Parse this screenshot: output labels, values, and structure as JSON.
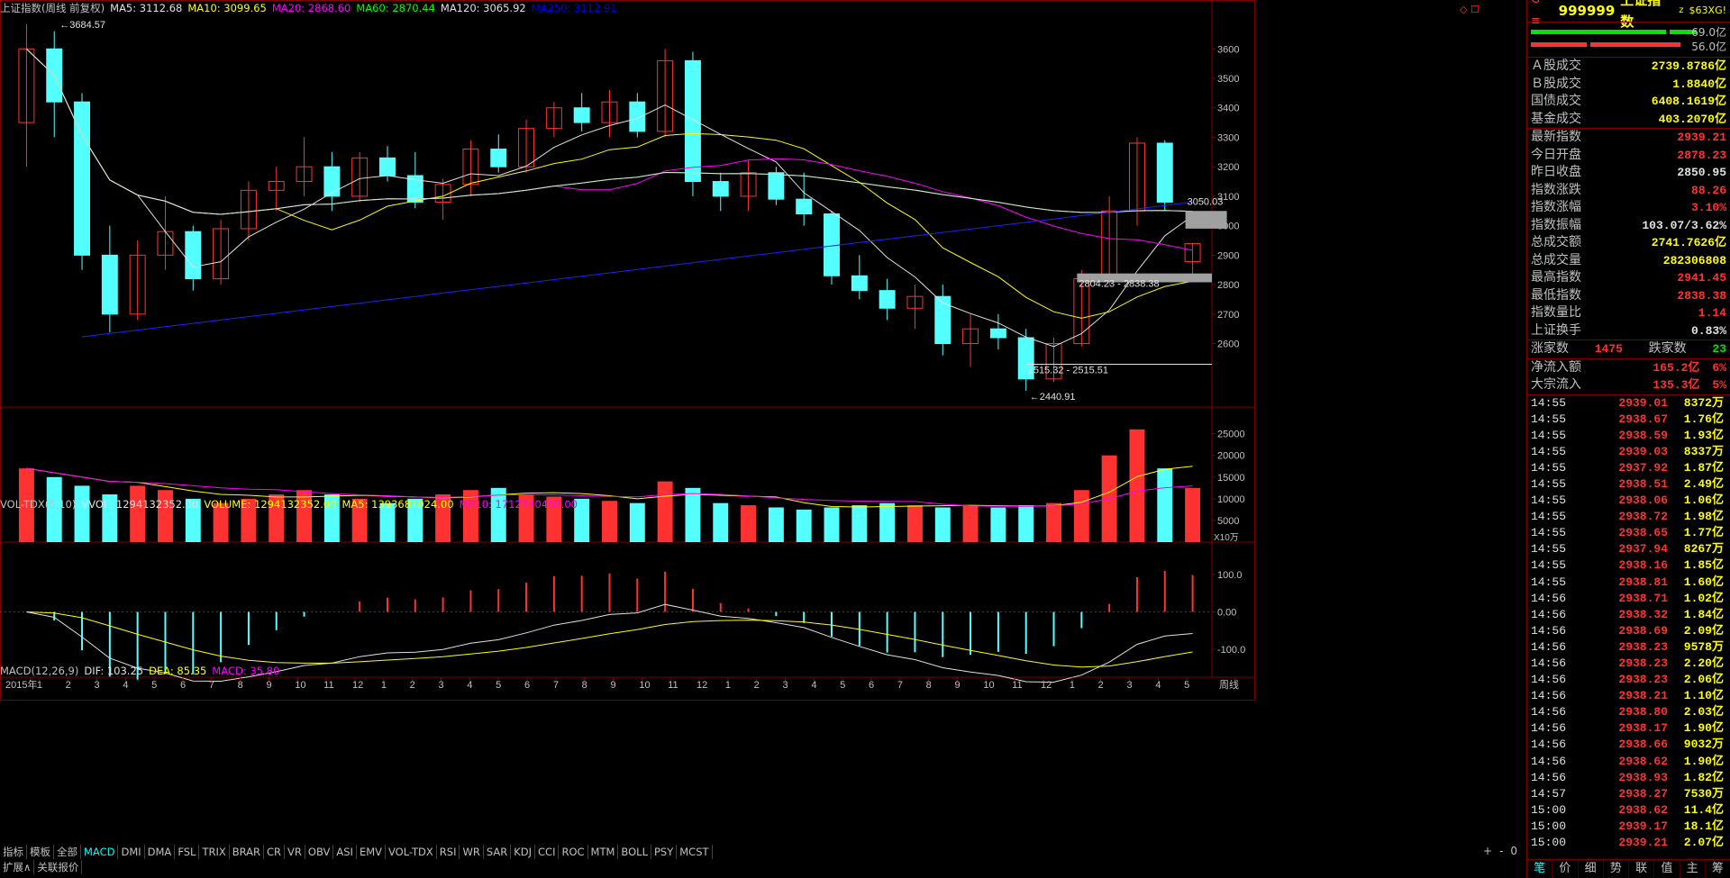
{
  "main_legend": [
    {
      "text": "上证指数(周线 前复权)",
      "color": "#c0c0c0"
    },
    {
      "text": "MA5: 3112.68",
      "color": "#e0e0e0"
    },
    {
      "text": "MA10: 3099.65",
      "color": "#ffff00"
    },
    {
      "text": "MA20: 2868.60",
      "color": "#ff00ff"
    },
    {
      "text": "MA60: 2870.44",
      "color": "#00ff00"
    },
    {
      "text": "MA120: 3065.92",
      "color": "#e0e0e0"
    },
    {
      "text": "MA250: 3112.91",
      "color": "#0000ff"
    }
  ],
  "vol_legend": [
    {
      "text": "VOL-TDX(5,10)",
      "color": "#c0c0c0"
    },
    {
      "text": "VVOL: 1294132352.00",
      "color": "#e0e0e0"
    },
    {
      "text": "VOLUME: 1294132352.00",
      "color": "#ffff00"
    },
    {
      "text": "MA5: 1393681024.00",
      "color": "#ffff00"
    },
    {
      "text": "MA10: 1712740480.00",
      "color": "#ff00ff"
    }
  ],
  "macd_legend": [
    {
      "text": "MACD(12,26,9)",
      "color": "#c0c0c0"
    },
    {
      "text": "DIF: 103.25",
      "color": "#e0e0e0"
    },
    {
      "text": "DEA: 85.35",
      "color": "#ffff00"
    },
    {
      "text": "MACD: 35.80",
      "color": "#ff00ff"
    }
  ],
  "annotations": {
    "high_label": "3684.57",
    "low_label": "2440.91",
    "label_3050": "3050.03",
    "gap1": "2804.23 - 2838.38",
    "gap2": "2515.32 - 2515.51"
  },
  "y_axis_main": [
    "3600",
    "3500",
    "3400",
    "3300",
    "3200",
    "3100",
    "3000",
    "2900",
    "2800",
    "2700",
    "2600"
  ],
  "y_axis_vol": [
    "25000",
    "20000",
    "15000",
    "10000",
    "5000"
  ],
  "vol_unit": "X10万",
  "y_axis_macd": [
    "100.0",
    "0.00",
    "-100.0"
  ],
  "period_label": "周线",
  "x_axis_labels": [
    "2015年",
    "1",
    "2",
    "3",
    "4",
    "5",
    "6",
    "7",
    "8",
    "9",
    "10",
    "11",
    "12",
    "1",
    "2",
    "3",
    "4",
    "5",
    "6",
    "7",
    "8",
    "9",
    "10",
    "11",
    "12",
    "1",
    "2",
    "3",
    "4",
    "5",
    "6",
    "7",
    "8",
    "9",
    "10",
    "11",
    "12",
    "1",
    "2",
    "3",
    "4",
    "5"
  ],
  "bottom_tabs_left": [
    "指标",
    "模板",
    "全部"
  ],
  "indicator_tabs": [
    "MACD",
    "DMI",
    "DMA",
    "FSL",
    "TRIX",
    "BRAR",
    "CR",
    "VR",
    "OBV",
    "ASI",
    "EMV",
    "VOL-TDX",
    "RSI",
    "WR",
    "SAR",
    "KDJ",
    "CCI",
    "ROC",
    "MTM",
    "BOLL",
    "PSY",
    "MCST"
  ],
  "bottom_row2": [
    "扩展∧",
    "关联报价"
  ],
  "zoom_controls": [
    "+",
    "-",
    "0"
  ],
  "stock": {
    "prefix": "G ≡",
    "code": "999999",
    "name": "上证指数",
    "suffix": "z",
    "tag": "$63XG!"
  },
  "ratio_bars": {
    "top_value": "69.0亿",
    "bottom_value": "56.0亿"
  },
  "trade_rows": [
    {
      "label": "Ａ股成交",
      "value": "2739.8786亿",
      "cls": "yel"
    },
    {
      "label": "Ｂ股成交",
      "value": "1.8840亿",
      "cls": "yel"
    },
    {
      "label": "国债成交",
      "value": "6408.1619亿",
      "cls": "yel"
    },
    {
      "label": "基金成交",
      "value": "403.2070亿",
      "cls": "yel"
    }
  ],
  "quote_rows": [
    {
      "label": "最新指数",
      "value": "2939.21",
      "cls": "red"
    },
    {
      "label": "今日开盘",
      "value": "2878.23",
      "cls": "red"
    },
    {
      "label": "昨日收盘",
      "value": "2850.95",
      "cls": "wht"
    },
    {
      "label": "指数涨跌",
      "value": "88.26",
      "cls": "red"
    },
    {
      "label": "指数涨幅",
      "value": "3.10%",
      "cls": "red"
    },
    {
      "label": "指数振幅",
      "value": "103.07/3.62%",
      "cls": "wht"
    },
    {
      "label": "总成交额",
      "value": "2741.7626亿",
      "cls": "yel"
    },
    {
      "label": "总成交量",
      "value": "282306808",
      "cls": "yel"
    },
    {
      "label": "最高指数",
      "value": "2941.45",
      "cls": "red"
    },
    {
      "label": "最低指数",
      "value": "2838.38",
      "cls": "red"
    },
    {
      "label": "指数量比",
      "value": "1.14",
      "cls": "red"
    },
    {
      "label": "上证换手",
      "value": "0.83%",
      "cls": "wht"
    }
  ],
  "breadth": {
    "up_label": "涨家数",
    "up_value": "1475",
    "down_label": "跌家数",
    "down_value": "23"
  },
  "flows": [
    {
      "label": "净流入额",
      "value": "165.2亿",
      "pct": "6%"
    },
    {
      "label": "大宗流入",
      "value": "135.3亿",
      "pct": "5%"
    }
  ],
  "ticks": [
    {
      "time": "14:55",
      "price": "2939.01",
      "vol": "8372万"
    },
    {
      "time": "14:55",
      "price": "2938.67",
      "vol": "1.76亿"
    },
    {
      "time": "14:55",
      "price": "2938.59",
      "vol": "1.93亿"
    },
    {
      "time": "14:55",
      "price": "2939.03",
      "vol": "8337万"
    },
    {
      "time": "14:55",
      "price": "2937.92",
      "vol": "1.87亿"
    },
    {
      "time": "14:55",
      "price": "2938.51",
      "vol": "2.49亿"
    },
    {
      "time": "14:55",
      "price": "2938.06",
      "vol": "1.06亿"
    },
    {
      "time": "14:55",
      "price": "2938.72",
      "vol": "1.98亿"
    },
    {
      "time": "14:55",
      "price": "2938.65",
      "vol": "1.77亿"
    },
    {
      "time": "14:55",
      "price": "2937.94",
      "vol": "8267万"
    },
    {
      "time": "14:55",
      "price": "2938.16",
      "vol": "1.85亿"
    },
    {
      "time": "14:55",
      "price": "2938.81",
      "vol": "1.60亿"
    },
    {
      "time": "14:56",
      "price": "2938.71",
      "vol": "1.02亿"
    },
    {
      "time": "14:56",
      "price": "2938.32",
      "vol": "1.84亿"
    },
    {
      "time": "14:56",
      "price": "2938.69",
      "vol": "2.09亿"
    },
    {
      "time": "14:56",
      "price": "2938.23",
      "vol": "9578万"
    },
    {
      "time": "14:56",
      "price": "2938.23",
      "vol": "2.20亿"
    },
    {
      "time": "14:56",
      "price": "2938.23",
      "vol": "2.06亿"
    },
    {
      "time": "14:56",
      "price": "2938.21",
      "vol": "1.10亿"
    },
    {
      "time": "14:56",
      "price": "2938.80",
      "vol": "2.03亿"
    },
    {
      "time": "14:56",
      "price": "2938.17",
      "vol": "1.90亿"
    },
    {
      "time": "14:56",
      "price": "2938.66",
      "vol": "9032万"
    },
    {
      "time": "14:56",
      "price": "2938.62",
      "vol": "1.90亿"
    },
    {
      "time": "14:56",
      "price": "2938.93",
      "vol": "1.82亿"
    },
    {
      "time": "14:57",
      "price": "2938.27",
      "vol": "7530万"
    },
    {
      "time": "15:00",
      "price": "2938.62",
      "vol": "11.4亿"
    },
    {
      "time": "15:00",
      "price": "2939.17",
      "vol": "18.1亿"
    },
    {
      "time": "15:00",
      "price": "2939.21",
      "vol": "2.07亿"
    }
  ],
  "right_tabs": [
    "笔",
    "价",
    "细",
    "势",
    "联",
    "值",
    "主",
    "筹"
  ],
  "colors": {
    "up": "#ff3232",
    "down": "#54ffff",
    "border": "#800000",
    "axis_text": "#c0c0c0"
  },
  "chart_data": {
    "type": "candlestick",
    "title": "上证指数(周线 前复权)",
    "candles_ohlc_approx": [
      [
        3350,
        3684,
        3200,
        3600
      ],
      [
        3600,
        3660,
        3300,
        3420
      ],
      [
        3420,
        3450,
        2850,
        2900
      ],
      [
        2900,
        3000,
        2638,
        2700
      ],
      [
        2700,
        2950,
        2680,
        2900
      ],
      [
        2900,
        3100,
        2850,
        2980
      ],
      [
        2980,
        3000,
        2780,
        2820
      ],
      [
        2820,
        3020,
        2800,
        2990
      ],
      [
        2990,
        3150,
        2950,
        3120
      ],
      [
        3120,
        3200,
        3050,
        3150
      ],
      [
        3150,
        3300,
        3100,
        3200
      ],
      [
        3200,
        3250,
        3050,
        3100
      ],
      [
        3100,
        3250,
        3080,
        3230
      ],
      [
        3230,
        3270,
        3150,
        3170
      ],
      [
        3170,
        3250,
        3060,
        3080
      ],
      [
        3080,
        3160,
        3020,
        3140
      ],
      [
        3140,
        3290,
        3100,
        3260
      ],
      [
        3260,
        3310,
        3180,
        3200
      ],
      [
        3200,
        3360,
        3180,
        3330
      ],
      [
        3330,
        3420,
        3300,
        3400
      ],
      [
        3400,
        3450,
        3320,
        3350
      ],
      [
        3350,
        3460,
        3300,
        3420
      ],
      [
        3420,
        3450,
        3300,
        3320
      ],
      [
        3320,
        3600,
        3300,
        3560
      ],
      [
        3560,
        3590,
        3100,
        3150
      ],
      [
        3150,
        3180,
        3050,
        3100
      ],
      [
        3100,
        3220,
        3050,
        3180
      ],
      [
        3180,
        3200,
        3070,
        3090
      ],
      [
        3090,
        3180,
        3000,
        3040
      ],
      [
        3040,
        3050,
        2800,
        2830
      ],
      [
        2830,
        2900,
        2750,
        2780
      ],
      [
        2780,
        2820,
        2680,
        2720
      ],
      [
        2720,
        2800,
        2650,
        2760
      ],
      [
        2760,
        2800,
        2560,
        2600
      ],
      [
        2600,
        2700,
        2520,
        2650
      ],
      [
        2650,
        2700,
        2580,
        2620
      ],
      [
        2620,
        2650,
        2440,
        2480
      ],
      [
        2480,
        2620,
        2470,
        2600
      ],
      [
        2600,
        2850,
        2590,
        2820
      ],
      [
        2820,
        3100,
        2800,
        3050
      ],
      [
        3050,
        3300,
        3000,
        3280
      ],
      [
        3280,
        3290,
        3050,
        3080
      ],
      [
        2878,
        2941,
        2838,
        2939
      ]
    ],
    "ma_lines": [
      "MA5",
      "MA10",
      "MA20",
      "MA60",
      "MA120",
      "MA250"
    ],
    "volume_unit": "X10万",
    "macd": {
      "DIF": 103.25,
      "DEA": 85.35,
      "MACD": 35.8
    }
  }
}
